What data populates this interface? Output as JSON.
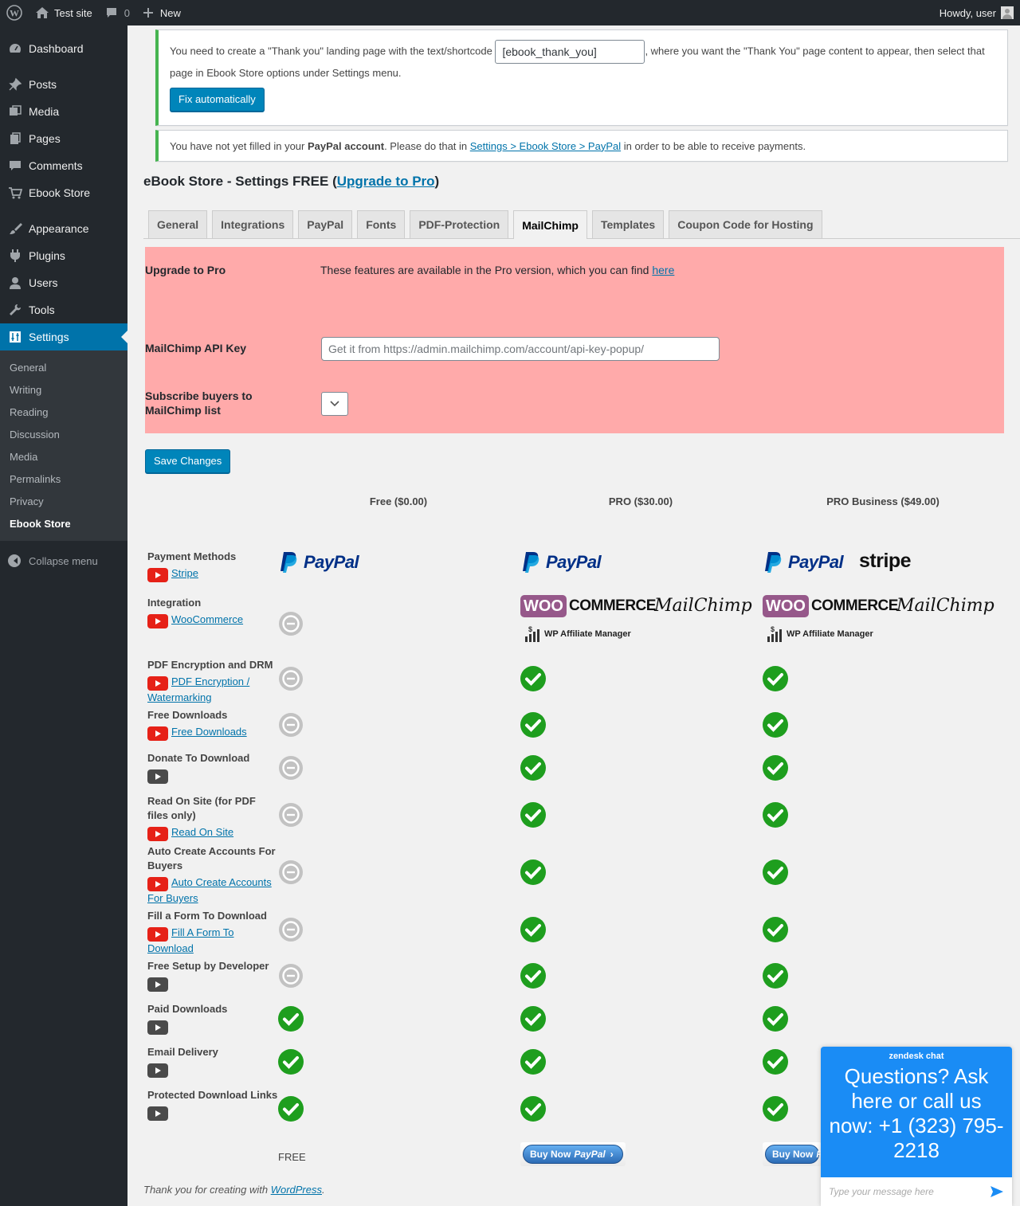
{
  "adminbar": {
    "site_name": "Test site",
    "comments_count": "0",
    "new_label": "New",
    "howdy": "Howdy, user"
  },
  "sidebar": {
    "items": [
      {
        "label": "Dashboard"
      },
      {
        "label": "Posts"
      },
      {
        "label": "Media"
      },
      {
        "label": "Pages"
      },
      {
        "label": "Comments"
      },
      {
        "label": "Ebook Store"
      },
      {
        "label": "Appearance"
      },
      {
        "label": "Plugins"
      },
      {
        "label": "Users"
      },
      {
        "label": "Tools"
      },
      {
        "label": "Settings"
      }
    ],
    "submenu": [
      "General",
      "Writing",
      "Reading",
      "Discussion",
      "Media",
      "Permalinks",
      "Privacy",
      "Ebook Store"
    ],
    "collapse": "Collapse menu"
  },
  "notice1": {
    "text_before": "You need to create a \"Thank you\" landing page with the text/shortcode",
    "shortcode": "[ebook_thank_you]",
    "text_after": ", where you want the \"Thank You\" page content to appear, then select that page in Ebook Store options under Settings menu.",
    "button": "Fix automatically"
  },
  "notice2": {
    "text1": "You have not yet filled in your ",
    "bold": "PayPal account",
    "text2": ". Please do that in ",
    "link": "Settings > Ebook Store > PayPal",
    "text3": " in order to be able to receive payments."
  },
  "page": {
    "title_prefix": "eBook Store - Settings FREE (",
    "title_link": "Upgrade to Pro",
    "title_suffix": ")"
  },
  "tabs": [
    "General",
    "Integrations",
    "PayPal",
    "Fonts",
    "PDF-Protection",
    "MailChimp",
    "Templates",
    "Coupon Code for Hosting"
  ],
  "pro": {
    "upgrade_label": "Upgrade to Pro",
    "upgrade_text": "These features are available in the Pro version, which you can find ",
    "upgrade_link": "here",
    "api_label": "MailChimp API Key",
    "api_placeholder": "Get it from https://admin.mailchimp.com/account/api-key-popup/",
    "subscribe_label": "Subscribe buyers to MailChimp list"
  },
  "save": "Save Changes",
  "compare": {
    "columns": [
      "Free ($0.00)",
      "PRO ($30.00)",
      "PRO Business ($49.00)"
    ],
    "rows": [
      {
        "label": "Payment Methods",
        "link": "Stripe"
      },
      {
        "label": "Integration",
        "link": "WooCommerce"
      },
      {
        "label": "PDF Encryption and DRM",
        "link": "PDF Encryption / Watermarking"
      },
      {
        "label": "Free Downloads",
        "link": "Free Downloads"
      },
      {
        "label": "Donate To Download",
        "link": ""
      },
      {
        "label": "Read On Site (for PDF files only)",
        "link": "Read On Site"
      },
      {
        "label": "Auto Create Accounts For Buyers",
        "link": "Auto Create Accounts For Buyers"
      },
      {
        "label": "Fill a Form To Download",
        "link": "Fill A Form To Download"
      },
      {
        "label": "Free Setup by Developer",
        "link": ""
      },
      {
        "label": "Paid Downloads",
        "link": ""
      },
      {
        "label": "Email Delivery",
        "link": ""
      },
      {
        "label": "Protected Download Links",
        "link": ""
      }
    ],
    "free_label": "FREE",
    "logos": {
      "paypal": "PayPal",
      "stripe": "stripe",
      "woo": "WOO",
      "commerce": "COMMERCE",
      "mailchimp": "MailChimp",
      "wpam": "WP Affiliate Manager"
    },
    "buy_now": "Buy Now",
    "buy_paypal": "PayPal"
  },
  "chat": {
    "brand": "zendesk chat",
    "question": "Questions? Ask here or call us now: +1 (323) 795-2218",
    "placeholder": "Type your message here"
  },
  "footer": {
    "text": "Thank you for creating with ",
    "link": "WordPress",
    "end": "."
  }
}
